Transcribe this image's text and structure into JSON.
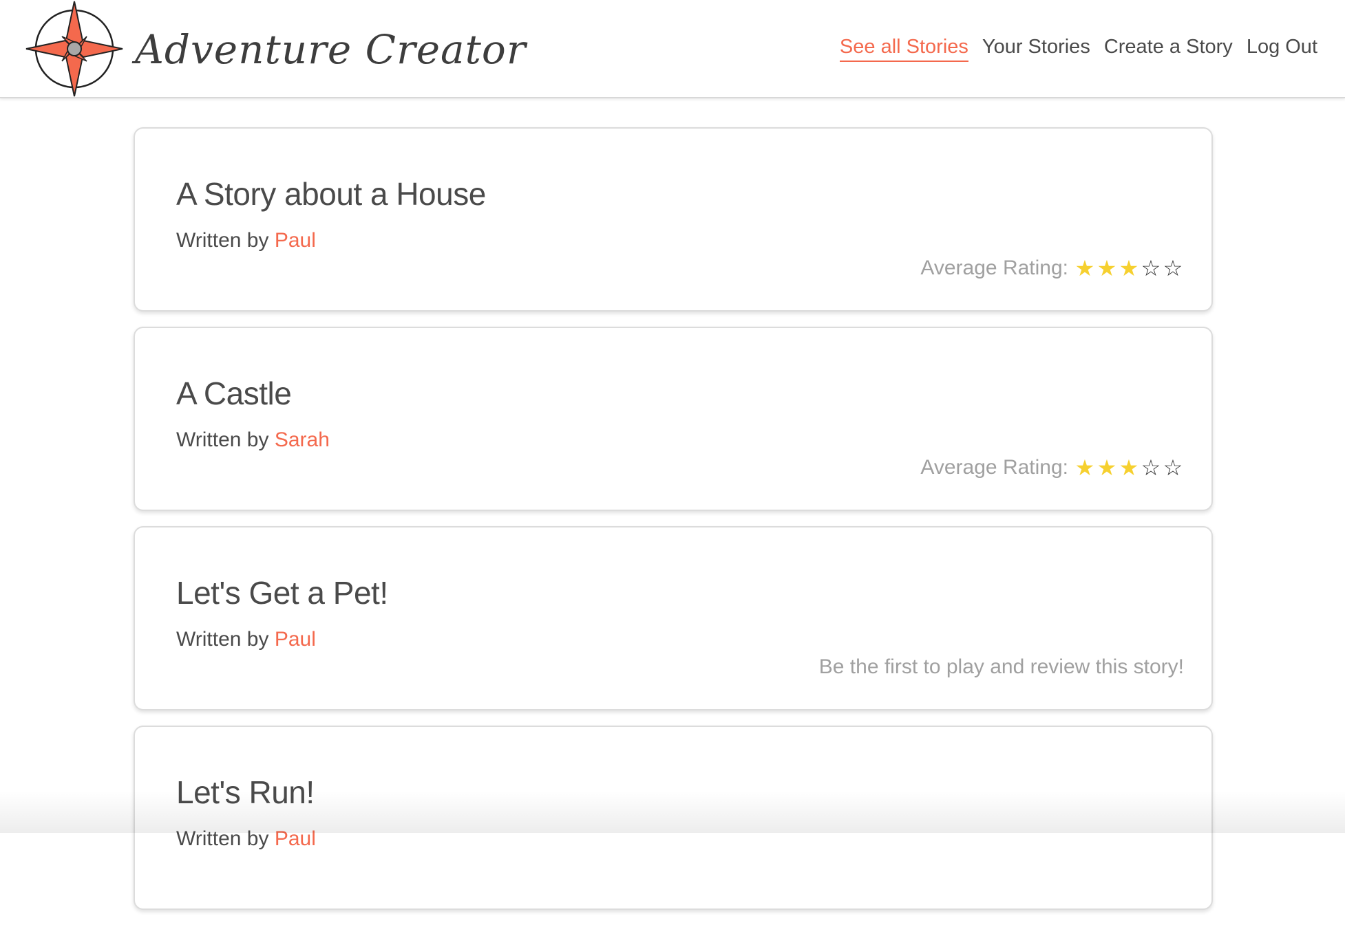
{
  "header": {
    "brand_name": "Adventure Creator",
    "logo_icon": "compass-rose-icon",
    "accent_color": "#f4694d",
    "nav": [
      {
        "label": "See all Stories",
        "active": true
      },
      {
        "label": "Your Stories",
        "active": false
      },
      {
        "label": "Create a Story",
        "active": false
      },
      {
        "label": "Log Out",
        "active": false
      }
    ]
  },
  "stories": [
    {
      "title": "A Story about a House",
      "byline_prefix": "Written by",
      "author": "Paul",
      "rating_label": "Average Rating:",
      "rating": 3,
      "rating_max": 5,
      "prompt": ""
    },
    {
      "title": "A Castle",
      "byline_prefix": "Written by",
      "author": "Sarah",
      "rating_label": "Average Rating:",
      "rating": 3,
      "rating_max": 5,
      "prompt": ""
    },
    {
      "title": "Let's Get a Pet!",
      "byline_prefix": "Written by",
      "author": "Paul",
      "rating_label": "",
      "rating": null,
      "rating_max": 5,
      "prompt": "Be the first to play and review this story!"
    },
    {
      "title": "Let's Run!",
      "byline_prefix": "Written by",
      "author": "Paul",
      "rating_label": "",
      "rating": null,
      "rating_max": 5,
      "prompt": ""
    }
  ],
  "colors": {
    "star_filled": "#f6d02f",
    "star_empty": "#333333",
    "muted_text": "#a0a0a0",
    "body_text": "#4a4a4a"
  }
}
